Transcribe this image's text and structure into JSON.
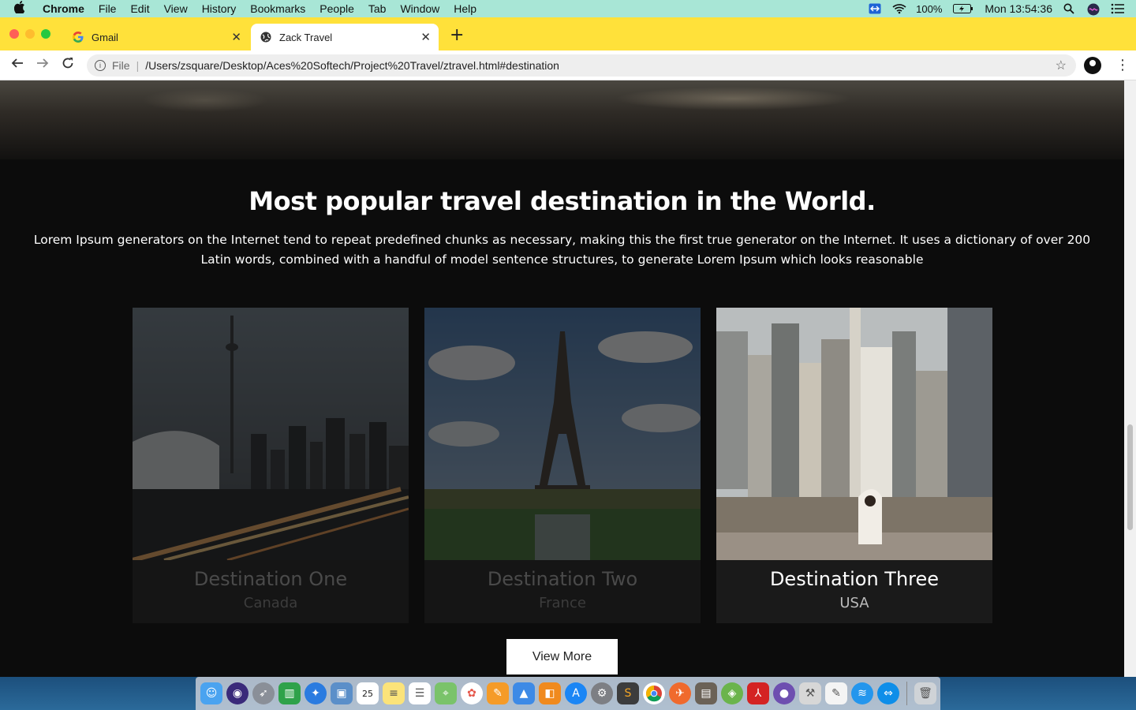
{
  "menubar": {
    "app_name": "Chrome",
    "items": [
      "File",
      "Edit",
      "View",
      "History",
      "Bookmarks",
      "People",
      "Tab",
      "Window",
      "Help"
    ],
    "battery": "100%",
    "clock": "Mon 13:54:36"
  },
  "tabs": [
    {
      "title": "Gmail",
      "active": false
    },
    {
      "title": "Zack Travel",
      "active": true
    }
  ],
  "address_bar": {
    "scheme_label": "File",
    "url": "/Users/zsquare/Desktop/Aces%20Softech/Project%20Travel/ztravel.html#destination"
  },
  "section": {
    "title": "Most popular travel destination in the World.",
    "description": "Lorem Ipsum generators on the Internet tend to repeat predefined chunks as necessary, making this the first true generator on the Internet. It uses a dictionary of over 200 Latin words, combined with a handful of model sentence structures, to generate Lorem Ipsum which looks reasonable"
  },
  "destinations": [
    {
      "name": "Destination One",
      "country": "Canada",
      "image": "toronto-skyline",
      "dimmed": true
    },
    {
      "name": "Destination Two",
      "country": "France",
      "image": "eiffel-tower",
      "dimmed": true
    },
    {
      "name": "Destination Three",
      "country": "USA",
      "image": "new-york-city",
      "dimmed": false
    }
  ],
  "view_more_label": "View More",
  "dock_apps": [
    "Finder",
    "Siri",
    "Launchpad",
    "Numbers",
    "Safari",
    "Preview",
    "Calendar",
    "Notes",
    "Reminders",
    "Maps",
    "Photos",
    "Pages",
    "Keynote",
    "Books",
    "App Store",
    "System Preferences",
    "Sublime Text",
    "Chrome",
    "Postman",
    "Notes Editor",
    "Android Studio",
    "Acrobat",
    "GitHub",
    "Xcode",
    "TextEdit",
    "Docker",
    "TeamViewer",
    "Trash"
  ],
  "calendar_day": "25"
}
